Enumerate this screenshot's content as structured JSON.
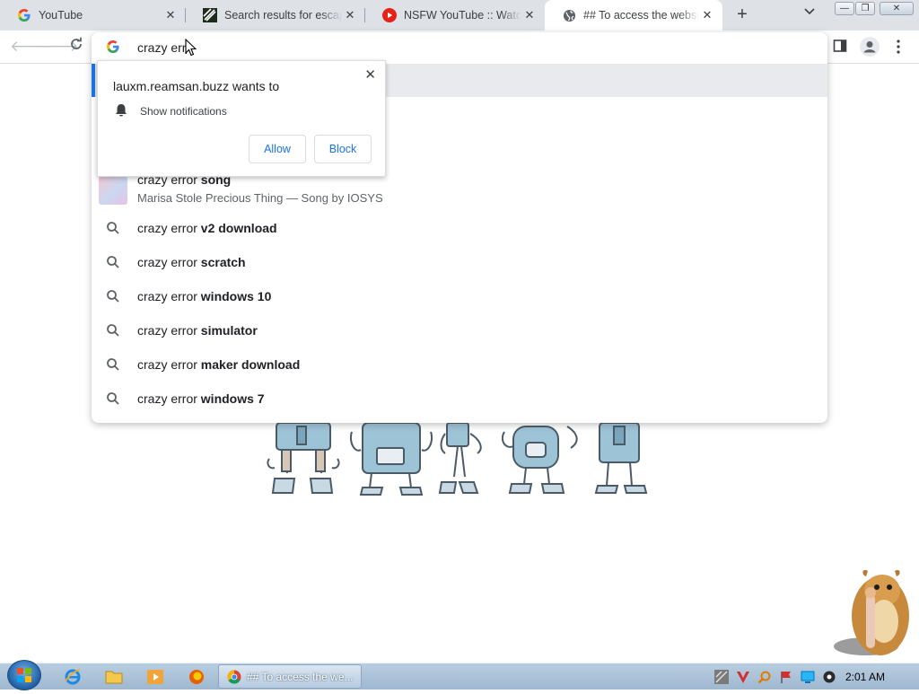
{
  "tabs": [
    {
      "title": "YouTube",
      "icon": "google-icon"
    },
    {
      "title": "Search results for escape",
      "icon": "site-favicon-icon"
    },
    {
      "title": "NSFW YouTube :: Watch YouTube",
      "icon": "youtube-icon"
    },
    {
      "title": "## To access the website",
      "icon": "globe-icon",
      "active": true
    }
  ],
  "omnibox": {
    "text": "crazy err",
    "suggestions_top": {
      "song_prefix": "crazy error ",
      "song_bold": "song",
      "song_sub": "Marisa Stole Precious Thing — Song by IOSYS"
    },
    "suggestions": [
      {
        "prefix": "crazy error ",
        "bold": "v2 download"
      },
      {
        "prefix": "crazy error ",
        "bold": "scratch"
      },
      {
        "prefix": "crazy error ",
        "bold": "windows 10"
      },
      {
        "prefix": "crazy error ",
        "bold": "simulator"
      },
      {
        "prefix": "crazy error ",
        "bold": "maker download"
      },
      {
        "prefix": "crazy error ",
        "bold": "windows 7"
      }
    ]
  },
  "notification_popup": {
    "title": "lauxm.reamsan.buzz wants to",
    "permission": "Show notifications",
    "allow_label": "Allow",
    "block_label": "Block",
    "close_symbol": "✕"
  },
  "taskbar": {
    "task_label": "## To access the we...",
    "clock": "2:01 AM"
  },
  "colors": {
    "accent": "#1a73e8",
    "tabstrip": "#dee1e6",
    "taskbar": "#b8cde0"
  }
}
